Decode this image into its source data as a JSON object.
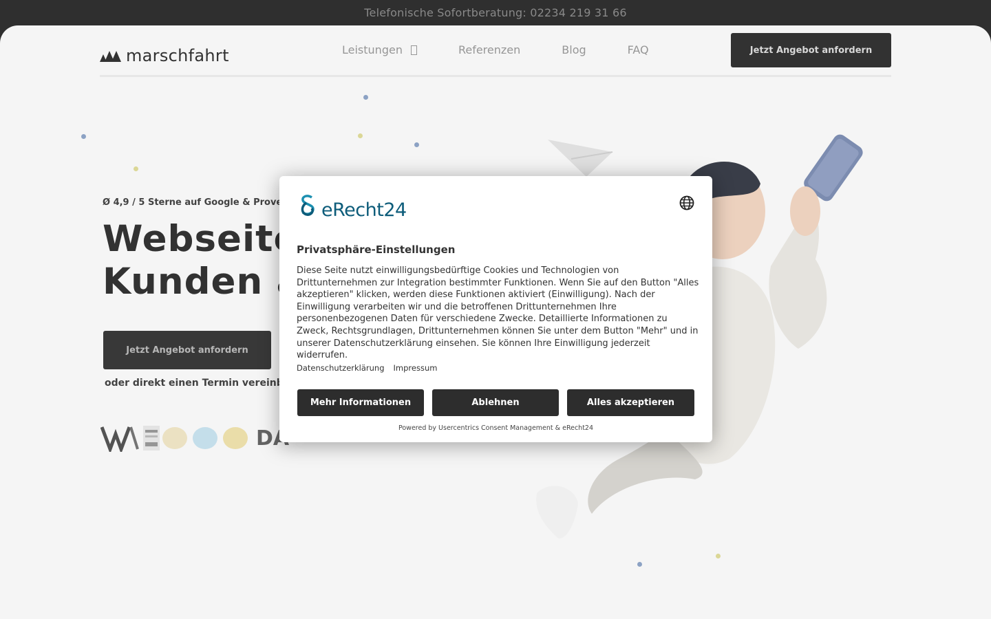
{
  "topbar": {
    "text": "Telefonische Sofortberatung: 02234 219 31 66"
  },
  "header": {
    "logo_text": "marschfahrt",
    "nav": [
      {
        "label": "Leistungen",
        "has_dropdown": true
      },
      {
        "label": "Referenzen"
      },
      {
        "label": "Blog"
      },
      {
        "label": "FAQ"
      }
    ],
    "cta_label": "Jetzt Angebot anfordern"
  },
  "hero": {
    "rating": "Ø 4,9 / 5 Sterne auf Google & Prove",
    "headline_line1": "Webseite",
    "headline_line2": "Kunden a",
    "cta_label": "Jetzt Angebot anfordern",
    "termin_text": "oder direkt einen Termin vereinb",
    "badge_da": "DA"
  },
  "consent": {
    "brand": "eRecht24",
    "title": "Privatsphäre-Einstellungen",
    "body": "Diese Seite nutzt einwilligungsbedürftige Cookies und Technologien von Drittunternehmen zur Integration bestimmter Funktionen. Wenn Sie auf den Button \"Alles akzeptieren\" klicken, werden diese Funktionen aktiviert (Einwilligung). Nach der Einwilligung verarbeiten wir und die betroffenen Drittunternehmen Ihre personenbezogenen Daten für verschiedene Zwecke. Detaillierte Informationen zu Zweck, Rechtsgrundlagen, Drittunternehmen können Sie unter dem Button \"Mehr\" und in unserer Datenschutzerklärung einsehen. Sie können Ihre Einwilligung jederzeit widerrufen.",
    "links": [
      "Datenschutzerklärung",
      "Impressum"
    ],
    "buttons": {
      "more": "Mehr Informationen",
      "deny": "Ablehnen",
      "accept": "Alles akzeptieren"
    },
    "powered_by": "Powered by Usercentrics Consent Management & eRecht24"
  },
  "colors": {
    "dark": "#303030",
    "brand_teal": "#0d5c7a",
    "page_bg": "#fafafa"
  }
}
